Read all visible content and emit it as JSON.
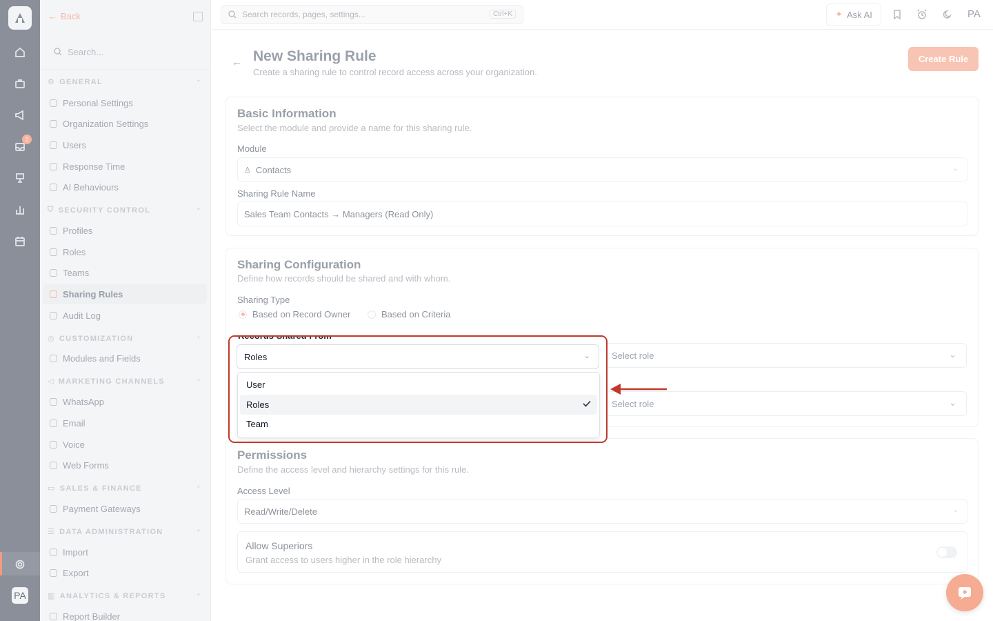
{
  "rail": {
    "notification_count": "2",
    "avatar_initials": "PA"
  },
  "sidebar": {
    "back_label": "Back",
    "search_placeholder": "Search...",
    "groups": [
      {
        "label": "GENERAL",
        "items": [
          "Personal Settings",
          "Organization Settings",
          "Users",
          "Response Time",
          "AI Behaviours"
        ]
      },
      {
        "label": "SECURITY CONTROL",
        "items": [
          "Profiles",
          "Roles",
          "Teams",
          "Sharing Rules",
          "Audit Log"
        ]
      },
      {
        "label": "CUSTOMIZATION",
        "items": [
          "Modules and Fields"
        ]
      },
      {
        "label": "MARKETING CHANNELS",
        "items": [
          "WhatsApp",
          "Email",
          "Voice",
          "Web Forms"
        ]
      },
      {
        "label": "SALES & FINANCE",
        "items": [
          "Payment Gateways"
        ]
      },
      {
        "label": "DATA ADMINISTRATION",
        "items": [
          "Import",
          "Export"
        ]
      },
      {
        "label": "ANALYTICS & REPORTS",
        "items": [
          "Report Builder"
        ]
      }
    ],
    "active_item": "Sharing Rules"
  },
  "topbar": {
    "search_placeholder": "Search records, pages, settings...",
    "shortcut": "Ctrl+K",
    "ask_ai_label": "Ask AI",
    "user_initials": "PA"
  },
  "page": {
    "title": "New Sharing Rule",
    "subtitle": "Create a sharing rule to control record access across your organization.",
    "create_button": "Create Rule"
  },
  "basic_info": {
    "title": "Basic Information",
    "subtitle": "Select the module and provide a name for this sharing rule.",
    "module_label": "Module",
    "module_value": "Contacts",
    "name_label": "Sharing Rule Name",
    "name_value": "Sales Team Contacts → Managers (Read Only)"
  },
  "sharing_config": {
    "title": "Sharing Configuration",
    "subtitle": "Define how records should be shared and with whom.",
    "type_label": "Sharing Type",
    "type_options": [
      "Based on Record Owner",
      "Based on Criteria"
    ],
    "type_selected": "Based on Record Owner",
    "shared_from_label": "Records Shared From",
    "shared_from_value": "Roles",
    "shared_from_options": [
      "User",
      "Roles",
      "Team"
    ],
    "role_placeholder_1": "Select role",
    "role_placeholder_2": "Select role"
  },
  "permissions": {
    "title": "Permissions",
    "subtitle": "Define the access level and hierarchy settings for this rule.",
    "access_label": "Access Level",
    "access_value": "Read/Write/Delete",
    "allow_superiors_title": "Allow Superiors",
    "allow_superiors_sub": "Grant access to users higher in the role hierarchy",
    "allow_superiors_enabled": false
  },
  "colors": {
    "accent": "#f29a83",
    "highlight_frame": "#c0392b"
  }
}
